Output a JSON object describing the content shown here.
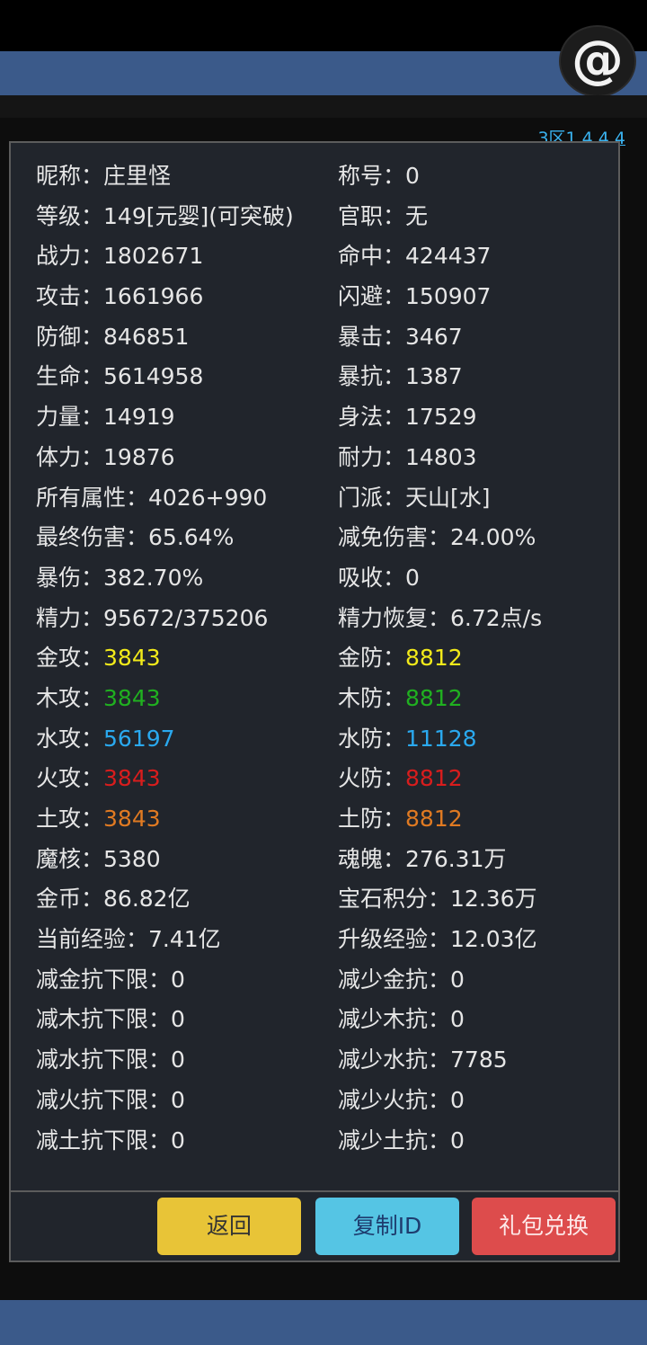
{
  "header": {
    "avatar_glyph": "@",
    "version": "3区1.4.4.4"
  },
  "colors": {
    "gold": "#f2ea1a",
    "wood": "#20b020",
    "water": "#2aa9ef",
    "fire": "#d81d1d",
    "earth": "#e07a22",
    "text": "#e6e6e6"
  },
  "stats": [
    [
      {
        "label": "昵称：",
        "value": "庄里怪"
      },
      {
        "label": "称号：",
        "value": "0"
      }
    ],
    [
      {
        "label": "等级：",
        "value": "149[元婴](可突破)"
      },
      {
        "label": "官职：",
        "value": "无"
      }
    ],
    [
      {
        "label": "战力：",
        "value": "1802671"
      },
      {
        "label": "命中：",
        "value": "424437"
      }
    ],
    [
      {
        "label": "攻击：",
        "value": "1661966"
      },
      {
        "label": "闪避：",
        "value": "150907"
      }
    ],
    [
      {
        "label": "防御：",
        "value": "846851"
      },
      {
        "label": "暴击：",
        "value": "3467"
      }
    ],
    [
      {
        "label": "生命：",
        "value": "5614958"
      },
      {
        "label": "暴抗：",
        "value": "1387"
      }
    ],
    [
      {
        "label": "力量：",
        "value": "14919"
      },
      {
        "label": "身法：",
        "value": "17529"
      }
    ],
    [
      {
        "label": "体力：",
        "value": "19876"
      },
      {
        "label": "耐力：",
        "value": "14803"
      }
    ],
    [
      {
        "label": "所有属性：",
        "value": "4026+990"
      },
      {
        "label": "门派：",
        "value": "天山[水]"
      }
    ],
    [
      {
        "label": "最终伤害：",
        "value": "65.64%"
      },
      {
        "label": "减免伤害：",
        "value": "24.00%"
      }
    ],
    [
      {
        "label": "暴伤：",
        "value": "382.70%"
      },
      {
        "label": "吸收：",
        "value": "0"
      }
    ],
    [
      {
        "label": "精力：",
        "value": "95672/375206"
      },
      {
        "label": "精力恢复：",
        "value": "6.72点/s"
      }
    ],
    [
      {
        "label": "金攻：",
        "value": "3843",
        "color": "gold"
      },
      {
        "label": "金防：",
        "value": "8812",
        "color": "gold"
      }
    ],
    [
      {
        "label": "木攻：",
        "value": "3843",
        "color": "wood"
      },
      {
        "label": "木防：",
        "value": "8812",
        "color": "wood"
      }
    ],
    [
      {
        "label": "水攻：",
        "value": "56197",
        "color": "water"
      },
      {
        "label": "水防：",
        "value": "11128",
        "color": "water"
      }
    ],
    [
      {
        "label": "火攻：",
        "value": "3843",
        "color": "fire"
      },
      {
        "label": "火防：",
        "value": "8812",
        "color": "fire"
      }
    ],
    [
      {
        "label": "土攻：",
        "value": "3843",
        "color": "earth"
      },
      {
        "label": "土防：",
        "value": "8812",
        "color": "earth"
      }
    ],
    [
      {
        "label": "魔核：",
        "value": "5380"
      },
      {
        "label": "魂魄：",
        "value": "276.31万"
      }
    ],
    [
      {
        "label": "金币：",
        "value": "86.82亿"
      },
      {
        "label": "宝石积分：",
        "value": "12.36万"
      }
    ],
    [
      {
        "label": "当前经验：",
        "value": "7.41亿"
      },
      {
        "label": "升级经验：",
        "value": "12.03亿"
      }
    ],
    [
      {
        "label": "减金抗下限：",
        "value": "0"
      },
      {
        "label": "减少金抗：",
        "value": "0"
      }
    ],
    [
      {
        "label": "减木抗下限：",
        "value": "0"
      },
      {
        "label": "减少木抗：",
        "value": "0"
      }
    ],
    [
      {
        "label": "减水抗下限：",
        "value": "0"
      },
      {
        "label": "减少水抗：",
        "value": "7785"
      }
    ],
    [
      {
        "label": "减火抗下限：",
        "value": "0"
      },
      {
        "label": "减少火抗：",
        "value": "0"
      }
    ],
    [
      {
        "label": "减土抗下限：",
        "value": "0"
      },
      {
        "label": "减少土抗：",
        "value": "0"
      }
    ]
  ],
  "footer": {
    "back_label": "返回",
    "copy_id_label": "复制ID",
    "gift_label": "礼包兑换"
  }
}
